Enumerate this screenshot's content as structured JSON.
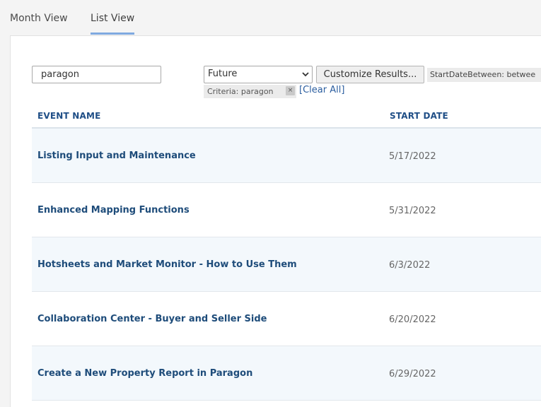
{
  "tabs": {
    "month_view": "Month View",
    "list_view": "List View"
  },
  "filters": {
    "search_value": "paragon",
    "select_value": "Future",
    "customize_label": "Customize Results...",
    "date_tag": "StartDateBetween: betwee",
    "criteria_chip": "Criteria: paragon",
    "remove_symbol": "×",
    "clear_all": "[Clear All]"
  },
  "table": {
    "col_name": "EVENT NAME",
    "col_date": "START DATE",
    "rows": [
      {
        "name": "Listing Input and Maintenance",
        "date": "5/17/2022"
      },
      {
        "name": "Enhanced Mapping Functions",
        "date": "5/31/2022"
      },
      {
        "name": "Hotsheets and Market Monitor - How to Use Them",
        "date": "6/3/2022"
      },
      {
        "name": "Collaboration Center - Buyer and Seller Side",
        "date": "6/20/2022"
      },
      {
        "name": "Create a New Property Report in Paragon",
        "date": "6/29/2022"
      }
    ]
  },
  "colors": {
    "accent_underline": "#7fa9e0",
    "header_text": "#1f4e86",
    "link": "#2a5d9f",
    "row_alt": "#f3f8fc"
  },
  "icons": {
    "select_arrow": "chevron-down-icon",
    "chip_remove": "close-icon"
  }
}
